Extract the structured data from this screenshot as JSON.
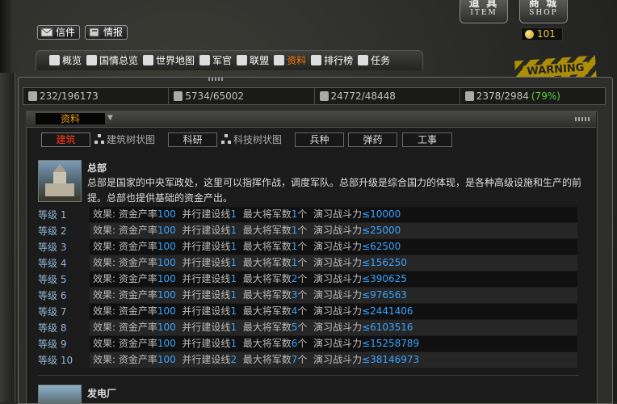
{
  "top": {
    "mail_label": "信件",
    "intel_label": "情报",
    "item": {
      "big": "道 具",
      "small": "ITEM"
    },
    "shop": {
      "big": "商 城",
      "small": "SHOP"
    },
    "coins": "101"
  },
  "nav": [
    {
      "label": "概览",
      "icon": "eye-icon"
    },
    {
      "label": "国情总览",
      "icon": "flag-icon"
    },
    {
      "label": "世界地图",
      "icon": "map-icon"
    },
    {
      "label": "军官",
      "icon": "officer-icon"
    },
    {
      "label": "联盟",
      "icon": "alliance-icon"
    },
    {
      "label": "资料",
      "icon": "document-icon",
      "active": true
    },
    {
      "label": "排行榜",
      "icon": "ranking-icon"
    },
    {
      "label": "任务",
      "icon": "star-icon"
    }
  ],
  "warning_text": "WARNING",
  "stats": [
    {
      "value": "232/196173",
      "icon": "funds-icon"
    },
    {
      "value": "5734/65002",
      "icon": "oil-icon"
    },
    {
      "value": "24772/48448",
      "icon": "steel-icon"
    },
    {
      "value": "2378/2984",
      "pct": "(79%)",
      "icon": "power-icon"
    }
  ],
  "panel": {
    "title": "资料",
    "tabs": {
      "build": "建筑",
      "build_tree": "建筑树状图",
      "research": "科研",
      "tech_tree": "科技树状图",
      "units": "兵种",
      "ammo": "弹药",
      "works": "工事"
    }
  },
  "building": {
    "name": "总部",
    "desc": "总部是国家的中央军政处，这里可以指挥作战，调度军队。总部升级是综合国力的体现，是各种高级设施和生产的前提。总部也提供基础的资金产出。",
    "labels": {
      "effect": "效果: ",
      "funds": "资金产率",
      "lines": "并行建设线",
      "generals": "最大将军数",
      "generals_unit": "个",
      "drill": "演习战斗力"
    },
    "levels": [
      {
        "name": "等级 1",
        "funds": "100",
        "lines": "1",
        "generals": "1",
        "drill": "≤10000"
      },
      {
        "name": "等级 2",
        "funds": "100",
        "lines": "1",
        "generals": "1",
        "drill": "≤25000"
      },
      {
        "name": "等级 3",
        "funds": "100",
        "lines": "1",
        "generals": "1",
        "drill": "≤62500"
      },
      {
        "name": "等级 4",
        "funds": "100",
        "lines": "1",
        "generals": "1",
        "drill": "≤156250"
      },
      {
        "name": "等级 5",
        "funds": "100",
        "lines": "1",
        "generals": "2",
        "drill": "≤390625"
      },
      {
        "name": "等级 6",
        "funds": "100",
        "lines": "1",
        "generals": "3",
        "drill": "≤976563"
      },
      {
        "name": "等级 7",
        "funds": "100",
        "lines": "1",
        "generals": "4",
        "drill": "≤2441406"
      },
      {
        "name": "等级 8",
        "funds": "100",
        "lines": "1",
        "generals": "5",
        "drill": "≤6103516"
      },
      {
        "name": "等级 9",
        "funds": "100",
        "lines": "1",
        "generals": "6",
        "drill": "≤15258789"
      },
      {
        "name": "等级 10",
        "funds": "100",
        "lines": "2",
        "generals": "7",
        "drill": "≤38146973"
      }
    ]
  },
  "building2": {
    "name": "发电厂"
  }
}
